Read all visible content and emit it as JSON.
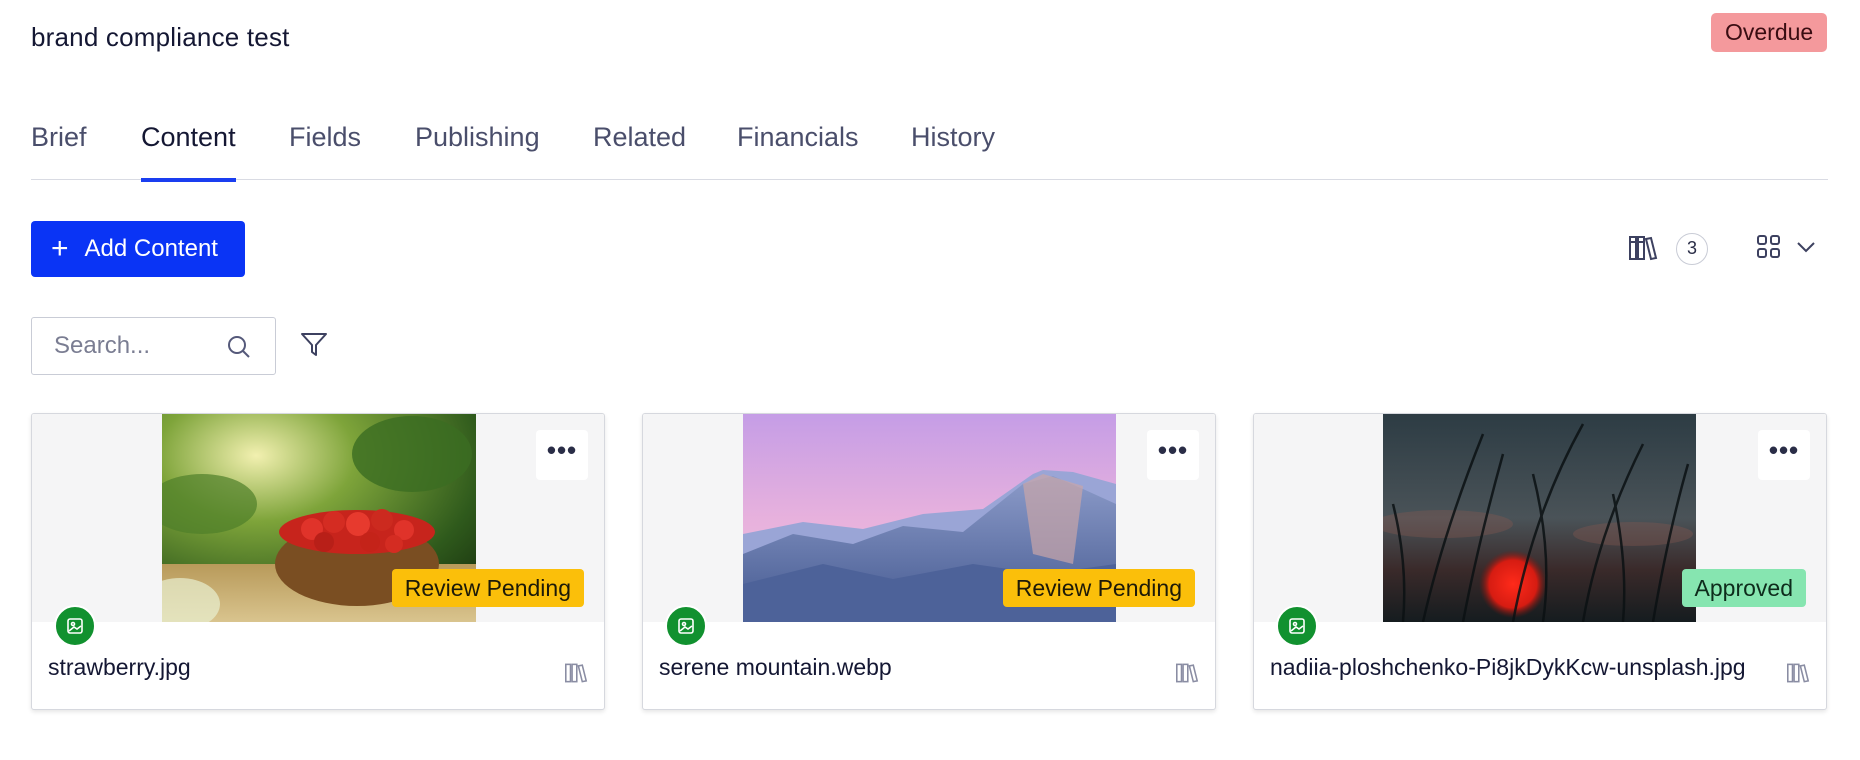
{
  "header": {
    "title": "brand compliance test",
    "status_badge": "Overdue"
  },
  "tabs": [
    {
      "label": "Brief",
      "active": false
    },
    {
      "label": "Content",
      "active": true
    },
    {
      "label": "Fields",
      "active": false
    },
    {
      "label": "Publishing",
      "active": false
    },
    {
      "label": "Related",
      "active": false
    },
    {
      "label": "Financials",
      "active": false
    },
    {
      "label": "History",
      "active": false
    }
  ],
  "toolbar": {
    "add_label": "Add Content",
    "library_count": "3",
    "library_icon": "library-books-icon",
    "view_icon": "grid-view-icon"
  },
  "search": {
    "placeholder": "Search...",
    "value": ""
  },
  "cards": [
    {
      "file_name": "strawberry.jpg",
      "status": "Review Pending",
      "status_kind": "pending",
      "type_icon": "image-icon"
    },
    {
      "file_name": "serene mountain.webp",
      "status": "Review Pending",
      "status_kind": "pending",
      "type_icon": "image-icon"
    },
    {
      "file_name": "nadiia-ploshchenko-Pi8jkDykKcw-unsplash.jpg",
      "status": "Approved",
      "status_kind": "approved",
      "type_icon": "image-icon"
    }
  ],
  "colors": {
    "accent": "#0a34f5",
    "overdue": "#f4999c",
    "pending": "#fbbf0a",
    "approved": "#86e5b0",
    "image_type": "#11912f"
  }
}
